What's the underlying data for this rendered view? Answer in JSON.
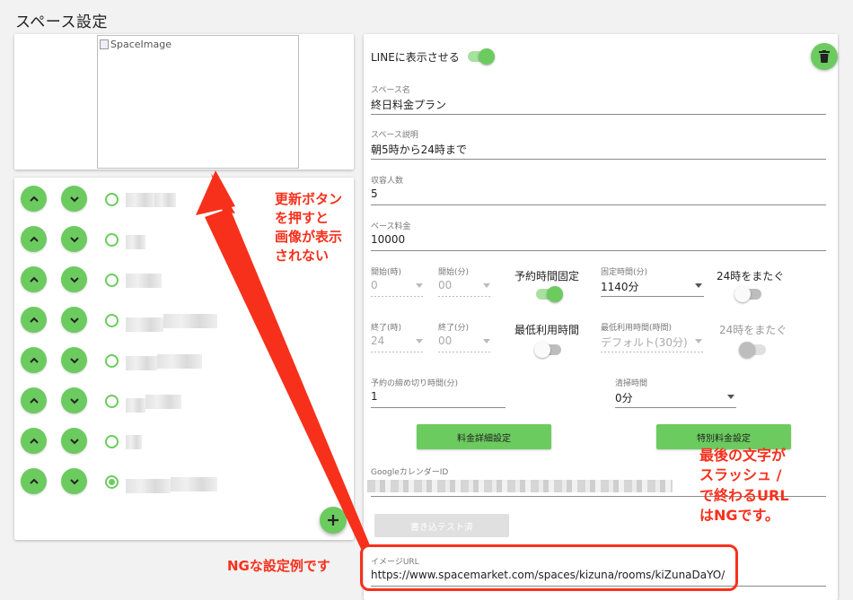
{
  "page": {
    "title": "スペース設定"
  },
  "image_card": {
    "alt": "SpaceImage"
  },
  "list": {
    "rows": [
      {
        "selected": false
      },
      {
        "selected": false
      },
      {
        "selected": false
      },
      {
        "selected": false
      },
      {
        "selected": false
      },
      {
        "selected": false
      },
      {
        "selected": false
      },
      {
        "selected": true
      }
    ]
  },
  "form": {
    "line_toggle": {
      "label": "LINEに表示させる",
      "on": true
    },
    "space_name": {
      "label": "スペース名",
      "value": "終日料金プラン"
    },
    "space_desc": {
      "label": "スペース説明",
      "value": "朝5時から24時まで"
    },
    "capacity": {
      "label": "収容人数",
      "value": "5"
    },
    "base_price": {
      "label": "ベース料金",
      "value": "10000"
    },
    "start_hour": {
      "label": "開始(時)",
      "value": "0"
    },
    "start_min": {
      "label": "開始(分)",
      "value": "00"
    },
    "fixed_time_toggle": {
      "label": "予約時間固定",
      "on": true
    },
    "fixed_time": {
      "label": "固定時間(分)",
      "value": "1140分"
    },
    "cross24_a": {
      "label": "24時をまたぐ",
      "on": false
    },
    "end_hour": {
      "label": "終了(時)",
      "value": "24"
    },
    "end_min": {
      "label": "終了(分)",
      "value": "00"
    },
    "min_time_toggle": {
      "label": "最低利用時間",
      "on": false
    },
    "min_time": {
      "label": "最低利用時間(時間)",
      "value": "デフォルト(30分)"
    },
    "cross24_b": {
      "label": "24時をまたぐ",
      "on": false
    },
    "deadline": {
      "label": "予約の締め切り時間(分)",
      "value": "1"
    },
    "cleaning": {
      "label": "清掃時間",
      "value": "0分"
    },
    "price_detail_button": "料金詳細設定",
    "special_price_button": "特別料金設定",
    "gcal": {
      "label": "GoogleカレンダーID"
    },
    "write_test_button": "書き込テスト済",
    "image_url": {
      "label": "イメージURL",
      "value": "https://www.spacemarket.com/spaces/kizuna/rooms/kiZunaDaYO/"
    }
  },
  "annotations": {
    "refresh_note": [
      "更新ボタン",
      "を押すと",
      "画像が表示",
      "されない"
    ],
    "slash_note": [
      "最後の文字が",
      "スラッシュ /",
      "で終わるURL",
      "はNGです。"
    ],
    "ng_example": "NGな設定例です"
  },
  "colors": {
    "accent": "#6ccb5f",
    "annotation": "#f7301c"
  }
}
